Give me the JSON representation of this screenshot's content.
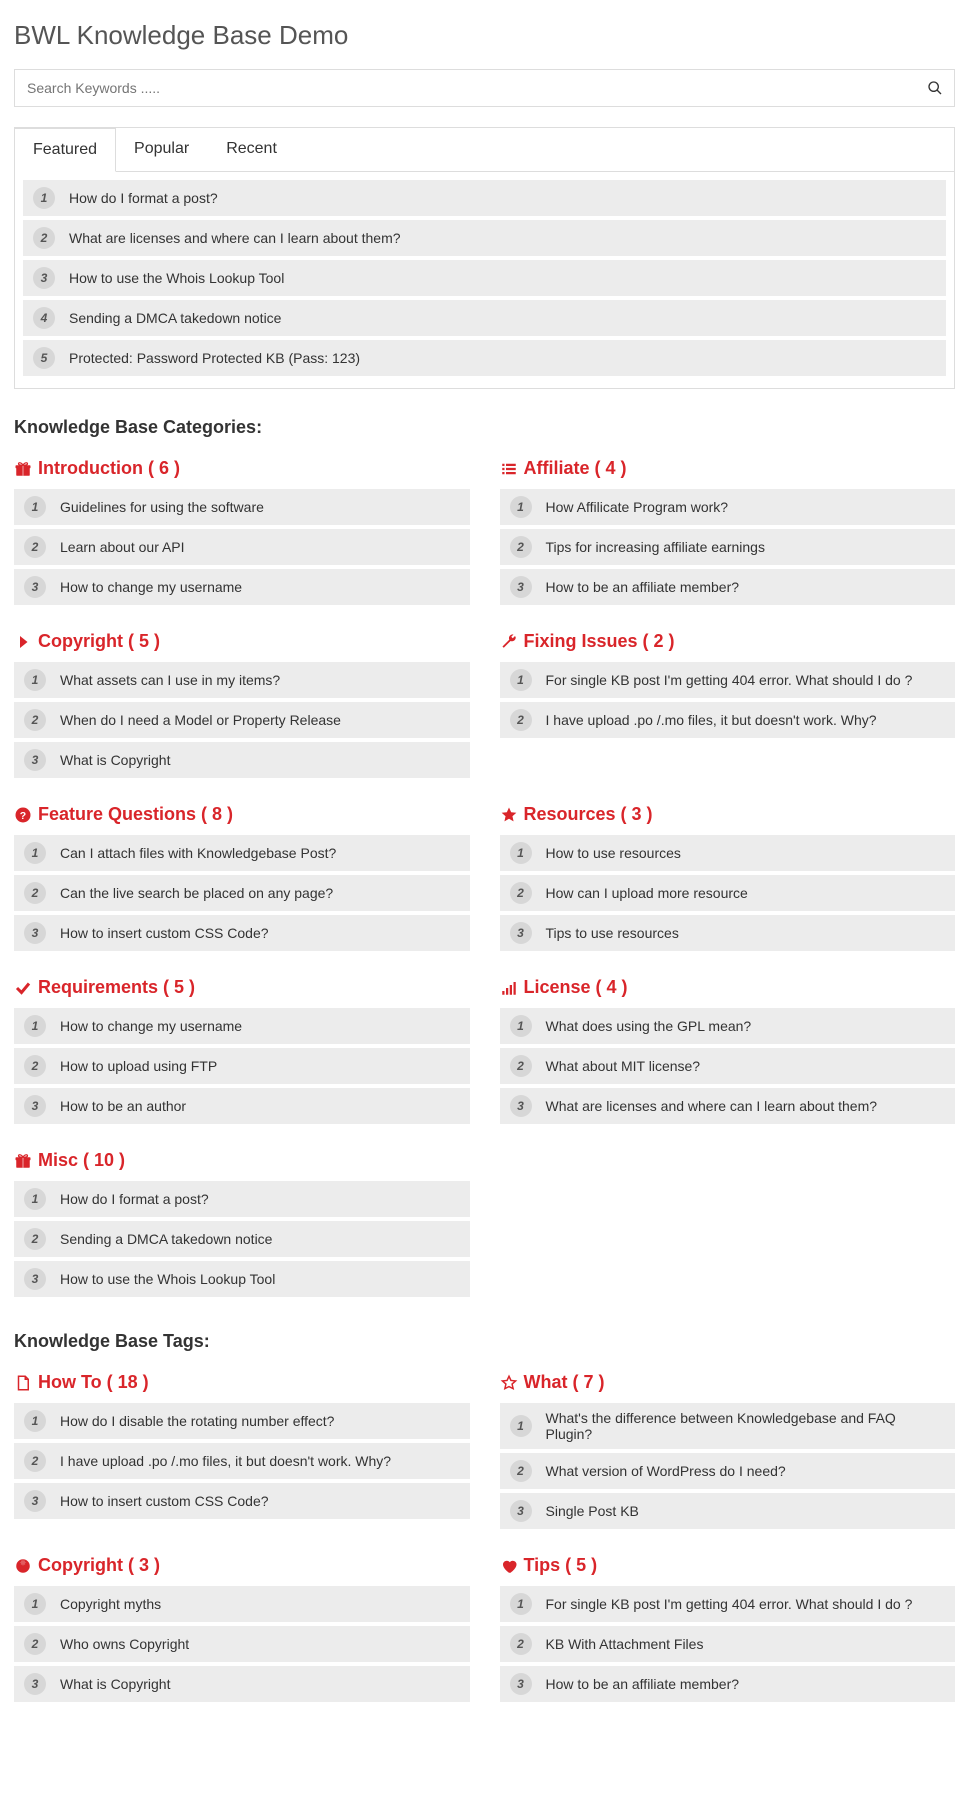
{
  "page_title": "BWL Knowledge Base Demo",
  "search": {
    "placeholder": "Search Keywords ....."
  },
  "tabs": [
    "Featured",
    "Popular",
    "Recent"
  ],
  "featured": [
    "How do I format a post?",
    "What are licenses and where can I learn about them?",
    "How to use the Whois Lookup Tool",
    "Sending a DMCA takedown notice",
    "Protected: Password Protected KB (Pass: 123)"
  ],
  "section_categories": "Knowledge Base Categories:",
  "categories": [
    {
      "icon": "gift",
      "title": "Introduction ( 6 )",
      "items": [
        "Guidelines for using the software",
        "Learn about our API",
        "How to change my username"
      ]
    },
    {
      "icon": "list",
      "title": "Affiliate ( 4 )",
      "items": [
        "How Affilicate Program work?",
        "Tips for increasing affiliate earnings",
        "How to be an affiliate member?"
      ]
    },
    {
      "icon": "chevron",
      "title": "Copyright ( 5 )",
      "items": [
        "What assets can I use in my items?",
        "When do I need a Model or Property Release",
        "What is Copyright"
      ]
    },
    {
      "icon": "wrench",
      "title": "Fixing Issues ( 2 )",
      "items": [
        "For single KB post I'm getting 404 error. What should I do ?",
        "I have upload .po /.mo files, it but doesn't work. Why?"
      ]
    },
    {
      "icon": "help",
      "title": "Feature Questions ( 8 )",
      "items": [
        "Can I attach files with Knowledgebase Post?",
        "Can the live search be placed on any page?",
        "How to insert custom CSS Code?"
      ]
    },
    {
      "icon": "star",
      "title": "Resources ( 3 )",
      "items": [
        "How to use resources",
        "How can I upload more resource",
        "Tips to use resources"
      ]
    },
    {
      "icon": "check",
      "title": "Requirements ( 5 )",
      "items": [
        "How to change my username",
        "How to upload using FTP",
        "How to be an author"
      ]
    },
    {
      "icon": "signal",
      "title": "License ( 4 )",
      "items": [
        "What does using the GPL mean?",
        "What about MIT license?",
        "What are licenses and where can I learn about them?"
      ]
    },
    {
      "icon": "gift",
      "title": "Misc ( 10 )",
      "items": [
        "How do I format a post?",
        "Sending a DMCA takedown notice",
        "How to use the Whois Lookup Tool"
      ]
    }
  ],
  "section_tags": "Knowledge Base Tags:",
  "tags": [
    {
      "icon": "file",
      "title": "How To ( 18 )",
      "items": [
        "How do I disable the rotating number effect?",
        "I have upload .po /.mo files, it but doesn't work. Why?",
        "How to insert custom CSS Code?"
      ]
    },
    {
      "icon": "star-out",
      "title": "What ( 7 )",
      "items": [
        "What's the difference between Knowledgebase and FAQ Plugin?",
        "What version of WordPress do I need?",
        "Single Post KB"
      ]
    },
    {
      "icon": "badge",
      "title": "Copyright ( 3 )",
      "items": [
        "Copyright myths",
        "Who owns Copyright",
        "What is Copyright"
      ]
    },
    {
      "icon": "heart",
      "title": "Tips ( 5 )",
      "items": [
        "For single KB post I'm getting 404 error. What should I do ?",
        "KB With Attachment Files",
        "How to be an affiliate member?"
      ]
    }
  ]
}
